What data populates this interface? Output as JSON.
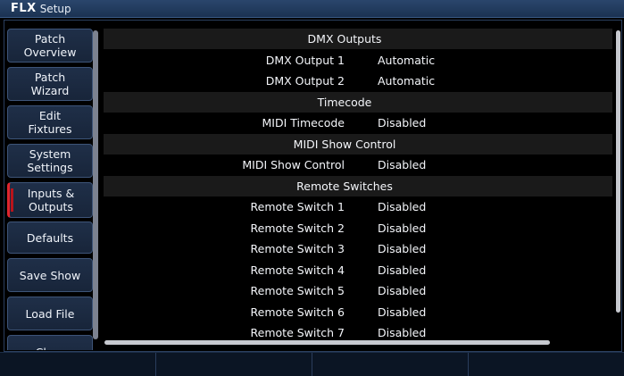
{
  "titlebar": {
    "brand": "FLX",
    "title": "Setup"
  },
  "sidebar": {
    "items": [
      {
        "label": "Patch\nOverview",
        "active": false
      },
      {
        "label": "Patch\nWizard",
        "active": false
      },
      {
        "label": "Edit\nFixtures",
        "active": false
      },
      {
        "label": "System\nSettings",
        "active": false
      },
      {
        "label": "Inputs &\nOutputs",
        "active": true
      },
      {
        "label": "Defaults",
        "active": false
      },
      {
        "label": "Save Show",
        "active": false
      },
      {
        "label": "Load File",
        "active": false
      },
      {
        "label": "Clear",
        "active": false
      }
    ]
  },
  "settings": {
    "rows": [
      {
        "type": "header",
        "label": "DMX Outputs"
      },
      {
        "type": "item",
        "label": "DMX Output 1",
        "value": "Automatic"
      },
      {
        "type": "item",
        "label": "DMX Output 2",
        "value": "Automatic"
      },
      {
        "type": "header",
        "label": "Timecode"
      },
      {
        "type": "item",
        "label": "MIDI Timecode",
        "value": "Disabled"
      },
      {
        "type": "header",
        "label": "MIDI Show Control"
      },
      {
        "type": "item",
        "label": "MIDI Show Control",
        "value": "Disabled"
      },
      {
        "type": "header",
        "label": "Remote Switches"
      },
      {
        "type": "item",
        "label": "Remote Switch 1",
        "value": "Disabled"
      },
      {
        "type": "item",
        "label": "Remote Switch 2",
        "value": "Disabled"
      },
      {
        "type": "item",
        "label": "Remote Switch 3",
        "value": "Disabled"
      },
      {
        "type": "item",
        "label": "Remote Switch 4",
        "value": "Disabled"
      },
      {
        "type": "item",
        "label": "Remote Switch 5",
        "value": "Disabled"
      },
      {
        "type": "item",
        "label": "Remote Switch 6",
        "value": "Disabled"
      },
      {
        "type": "item",
        "label": "Remote Switch 7",
        "value": "Disabled"
      }
    ]
  },
  "footer": {
    "segments": [
      "",
      "",
      "",
      ""
    ]
  },
  "colors": {
    "accent_active": "#e0252d",
    "header_row": "#1a1a1a",
    "titlebar": "#1b3252"
  }
}
